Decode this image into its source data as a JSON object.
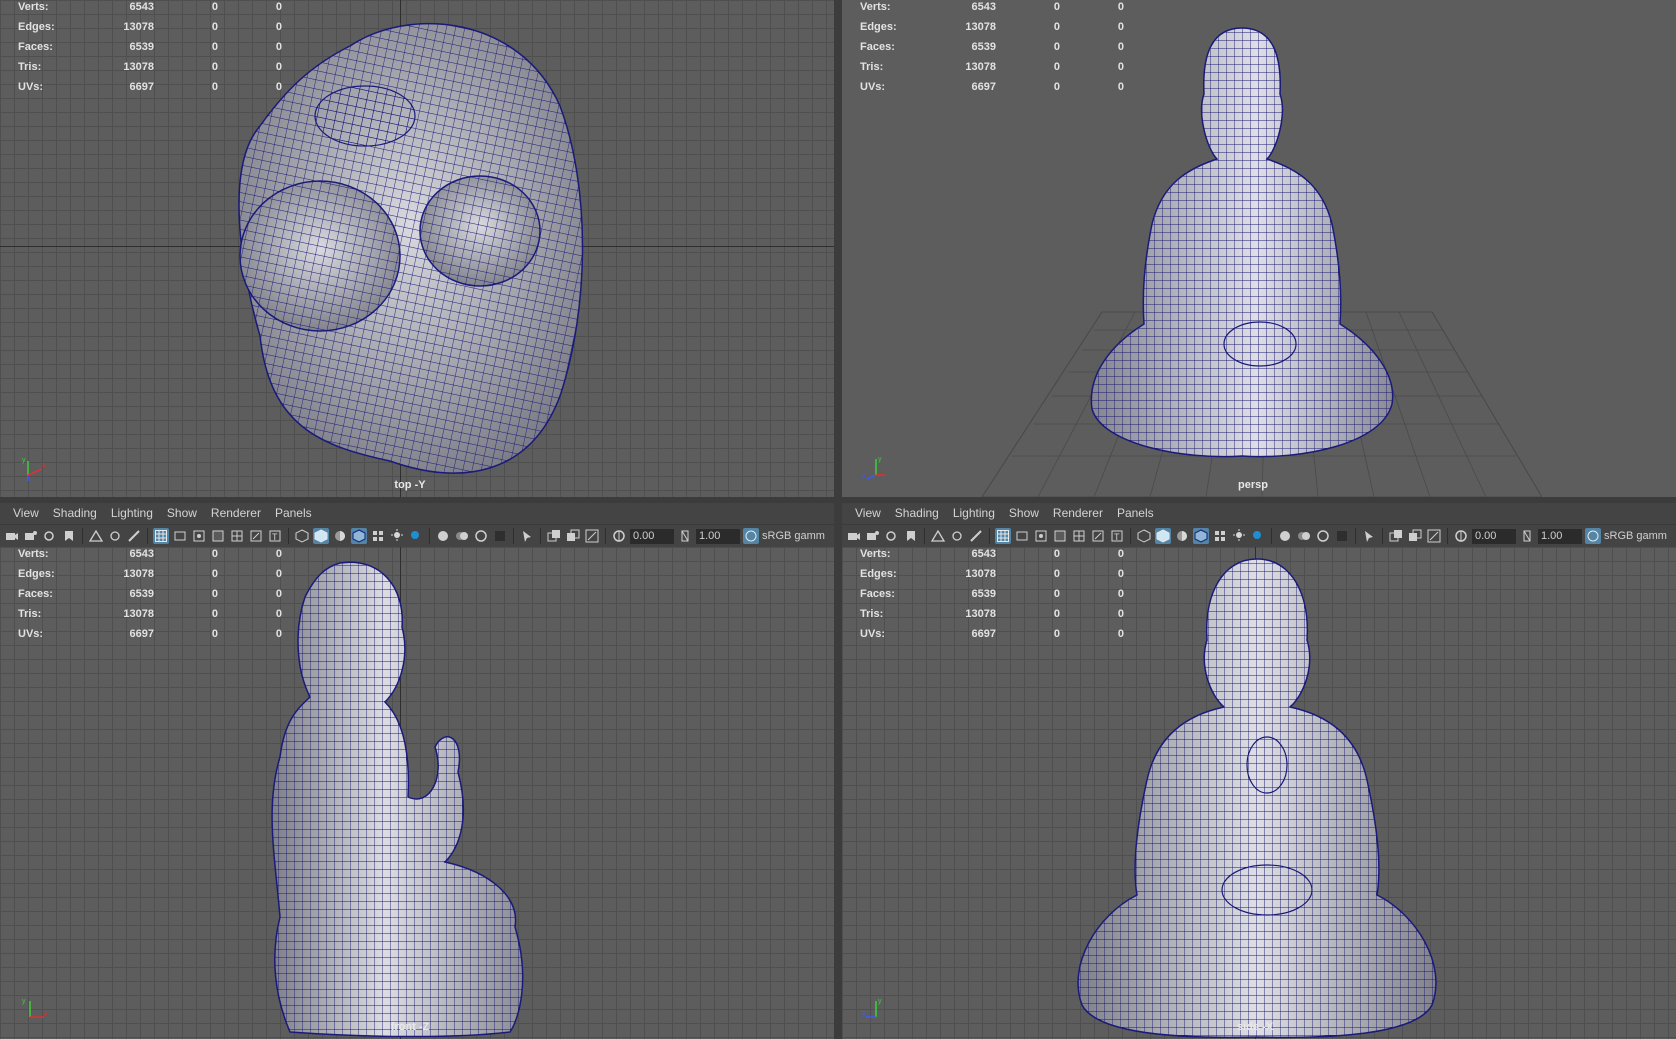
{
  "menus": [
    "View",
    "Shading",
    "Lighting",
    "Show",
    "Renderer",
    "Panels"
  ],
  "toolbar": {
    "exposure_value": "0.00",
    "gamma_value": "1.00",
    "color_space": "sRGB gamm"
  },
  "hud_labels": {
    "verts": "Verts:",
    "edges": "Edges:",
    "faces": "Faces:",
    "tris": "Tris:",
    "uvs": "UVs:"
  },
  "hud_values": {
    "verts": [
      "6543",
      "0",
      "0"
    ],
    "edges": [
      "13078",
      "0",
      "0"
    ],
    "faces": [
      "6539",
      "0",
      "0"
    ],
    "tris": [
      "13078",
      "0",
      "0"
    ],
    "uvs": [
      "6697",
      "0",
      "0"
    ]
  },
  "panels": {
    "top": {
      "camera": "top -Y"
    },
    "persp": {
      "camera": "persp"
    },
    "front": {
      "camera": "front -Z"
    },
    "side": {
      "camera": "side -X"
    }
  },
  "colors": {
    "viewport_bg": "#5d5d5d",
    "grid_line": "#4f4f4f",
    "wire": "#1a1a7a",
    "surface": "#a9a9b1",
    "toolbar_bg": "#444444",
    "active_button": "#5285a6"
  },
  "icons": {
    "camera": "camera-icon",
    "grid": "grid-icon",
    "wireframe": "wireframe-icon",
    "smooth_shade": "smooth-shade-icon",
    "light": "light-icon",
    "isolate": "isolate-icon"
  }
}
